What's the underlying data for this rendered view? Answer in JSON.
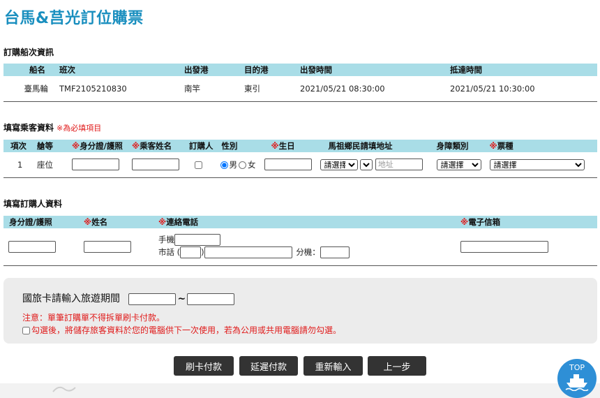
{
  "page": {
    "title": "台馬&莒光訂位購票"
  },
  "voyage": {
    "section_title": "訂購船次資訊",
    "columns": [
      "船名",
      "班次",
      "出發港",
      "目的港",
      "出發時間",
      "抵達時間"
    ],
    "row": {
      "ship": "臺馬輪",
      "trip_no": "TMF2105210830",
      "depart_port": "南竿",
      "arrive_port": "東引",
      "depart_time": "2021/05/21 08:30:00",
      "arrive_time": "2021/05/21 10:30:00"
    }
  },
  "passenger": {
    "section_title": "填寫乘客資料",
    "required_note": "※為必填項目",
    "required_mark": "※",
    "columns": {
      "item": "項次",
      "cabin": "艙等",
      "id": "身分證/護照",
      "name": "乘客姓名",
      "orderer": "訂購人",
      "gender": "性別",
      "birthday": "生日",
      "address": "馬祖鄉民請填地址",
      "disability": "身障類別",
      "ticket_type": "票種"
    },
    "row": {
      "item": "1",
      "cabin": "座位",
      "gender_male": "男",
      "gender_female": "女",
      "gender_selected": "male",
      "orderer_checked": false,
      "address_select_value": "請選擇",
      "address_select2_value": "",
      "address_placeholder": "地址",
      "disability_select_value": "請選擇",
      "ticket_select_value": "請選擇"
    }
  },
  "orderer": {
    "section_title": "填寫訂購人資料",
    "columns": {
      "id": "身分證/護照",
      "name": "姓名",
      "phone": "連絡電話",
      "email": "電子信箱"
    },
    "mobile_label": "手機",
    "landline_label": "市話",
    "paren_open": "(",
    "paren_close": ")",
    "ext_label": "分機："
  },
  "travel_card": {
    "label": "國旅卡請輸入旅遊期間",
    "separator": "~",
    "notice": "注意：單筆訂購單不得拆單刷卡付款。",
    "save_checkbox_label": "勾選後，將儲存旅客資料於您的電腦供下一次使用，若為公用或共用電腦請勿勾選。",
    "save_checked": false
  },
  "buttons": {
    "pay_card": "刷卡付款",
    "pay_later": "延遲付款",
    "reset": "重新輸入",
    "back": "上一步"
  },
  "top_button": {
    "label": "TOP",
    "icon": "ship-icon"
  },
  "colors": {
    "title": "#1a8fbf",
    "table_header": "#a9dde7",
    "required": "#e01a1a",
    "button": "#333333",
    "top_button": "#2e8fd6"
  }
}
